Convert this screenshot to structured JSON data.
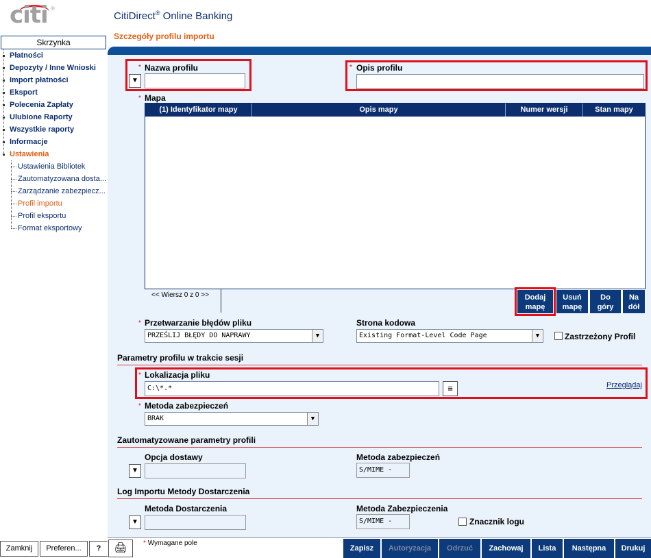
{
  "header": {
    "logo_text": "citi",
    "logo_reg": "®",
    "app_title": "CitiDirect",
    "app_title_reg": "®",
    "app_title_rest": " Online Banking",
    "page_title": "Szczegóły profilu importu"
  },
  "sidebar": {
    "inbox": "Skrzynka",
    "items": [
      {
        "label": "Płatności"
      },
      {
        "label": "Depozyty / Inne Wnioski"
      },
      {
        "label": "Import płatności"
      },
      {
        "label": "Eksport"
      },
      {
        "label": "Polecenia Zapłaty"
      },
      {
        "label": "Ulubione Raporty"
      },
      {
        "label": "Wszystkie raporty"
      },
      {
        "label": "Informacje"
      },
      {
        "label": "Ustawienia"
      }
    ],
    "subitems": [
      {
        "label": "Ustawienia Bibliotek"
      },
      {
        "label": "Zautomatyzowana dosta..."
      },
      {
        "label": "Zarządzanie zabezpiecz..."
      },
      {
        "label": "Profil importu"
      },
      {
        "label": "Profil eksportu"
      },
      {
        "label": "Format eksportowy"
      }
    ],
    "buttons": {
      "close": "Zamknij",
      "prefs": "Preferen...",
      "help": "?"
    }
  },
  "form": {
    "required_mark": "*",
    "profile_name": {
      "label": "Nazwa profilu",
      "value": ""
    },
    "profile_desc": {
      "label": "Opis profilu",
      "value": ""
    },
    "map": {
      "label": "Mapa",
      "columns": [
        "(1) Identyfikator mapy",
        "Opis mapy",
        "Numer wersji",
        "Stan mapy"
      ],
      "rows": [],
      "pager": "<< Wiersz 0 z 0 >>"
    },
    "map_buttons": {
      "add": [
        "Dodaj",
        "mapę"
      ],
      "remove": [
        "Usuń",
        "mapę"
      ],
      "up": [
        "Do",
        "góry"
      ],
      "down": [
        "Na",
        "dół"
      ]
    },
    "file_error": {
      "label": "Przetwarzanie błędów pliku",
      "value": "PRZEŚLIJ BŁĘDY DO NAPRAWY"
    },
    "codepage": {
      "label": "Strona kodowa",
      "value": "Existing Format-Level Code Page"
    },
    "restricted": {
      "label": "Zastrzeżony Profil",
      "checked": false
    },
    "session_section": "Parametry profilu w trakcie sesji",
    "file_location": {
      "label": "Lokalizacja pliku",
      "value": "C:\\*.*",
      "browse": "Przeglądaj"
    },
    "security_method": {
      "label": "Metoda zabezpieczeń",
      "value": "BRAK"
    },
    "auto_section": "Zautomatyzowane parametry profili",
    "delivery_option": {
      "label": "Opcja dostawy",
      "value": ""
    },
    "auto_security": {
      "label": "Metoda zabezpieczeń",
      "value": "S/MIME -"
    },
    "log_section": "Log Importu Metody Dostarczenia",
    "delivery_method": {
      "label": "Metoda Dostarczenia",
      "value": ""
    },
    "log_security": {
      "label": "Metoda Zabezpieczenia",
      "value": "S/MIME -"
    },
    "log_flag": {
      "label": "Znacznik logu",
      "checked": false
    }
  },
  "footer": {
    "required_note": "Wymagane pole",
    "actions": [
      {
        "label": "Zapisz",
        "enabled": true
      },
      {
        "label": "Autoryzacja",
        "enabled": false
      },
      {
        "label": "Odrzuć",
        "enabled": false
      },
      {
        "label": "Zachowaj",
        "enabled": true
      },
      {
        "label": "Lista",
        "enabled": true
      },
      {
        "label": "Następna",
        "enabled": true
      },
      {
        "label": "Drukuj",
        "enabled": true
      }
    ]
  }
}
